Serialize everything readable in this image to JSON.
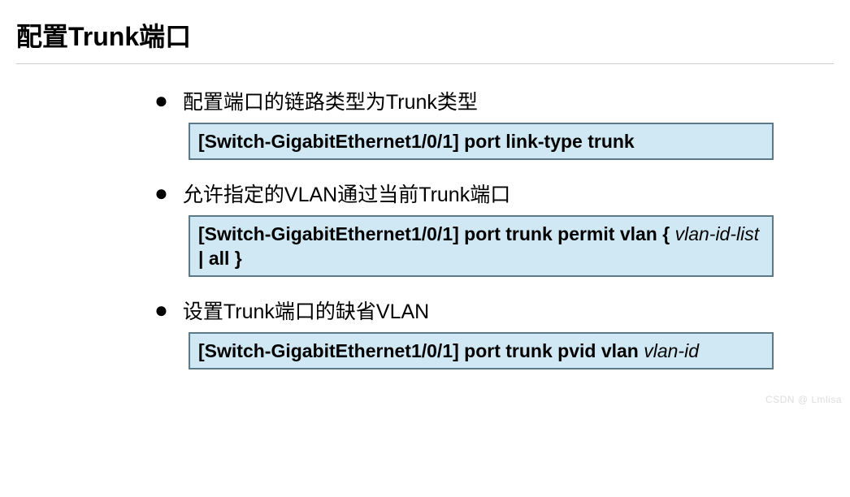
{
  "title": "配置Trunk端口",
  "items": [
    {
      "label": "配置端口的链路类型为Trunk类型",
      "prompt": "[Switch-GigabitEthernet1/0/1]",
      "cmd": " port link-type trunk",
      "param": "",
      "sep1": "",
      "sep2": ""
    },
    {
      "label": "允许指定的VLAN通过当前Trunk端口",
      "prompt": "[Switch-GigabitEthernet1/0/1]",
      "cmd": " port trunk permit vlan ",
      "sep1": "{ ",
      "param": "vlan-id-list",
      "sep2": " | all }"
    },
    {
      "label": "设置Trunk端口的缺省VLAN",
      "prompt": "[Switch-GigabitEthernet1/0/1]",
      "cmd": " port trunk pvid vlan",
      "sep1": " ",
      "param": "vlan-id",
      "sep2": ""
    }
  ],
  "watermark": "CSDN @ Lmlisa"
}
